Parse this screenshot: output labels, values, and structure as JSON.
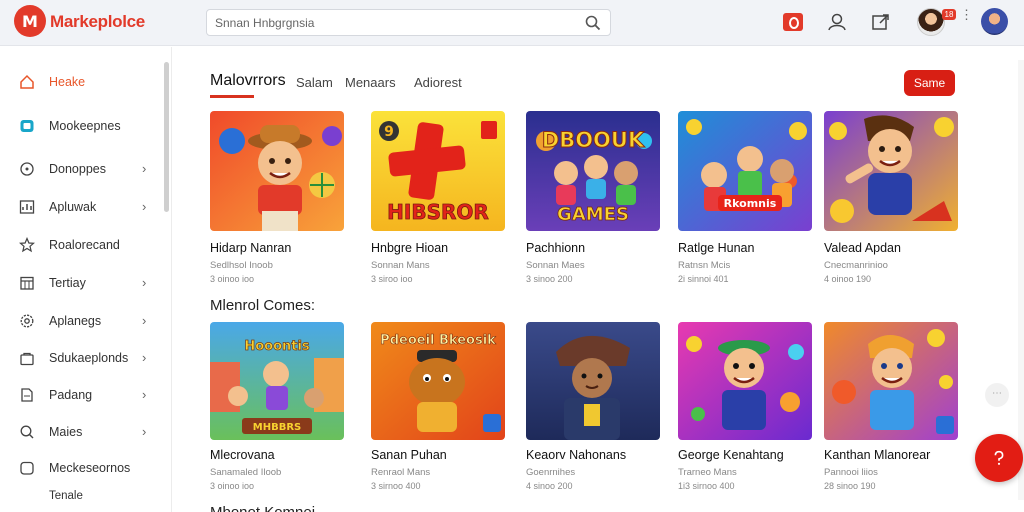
{
  "header": {
    "logo_letter": "M",
    "logo_text": "Markeplolce",
    "search_placeholder": "Snnan Hnbgrgnsia",
    "notification_badge": "18"
  },
  "sidebar": {
    "items": [
      {
        "label": "Heake",
        "icon": "home-icon",
        "chevron": false
      },
      {
        "label": "Mookeepnes",
        "icon": "market-icon",
        "chevron": false
      },
      {
        "label": "Donoppes",
        "icon": "circle-icon",
        "chevron": true
      },
      {
        "label": "Apluwak",
        "icon": "chart-icon",
        "chevron": true
      },
      {
        "label": "Roalorecand",
        "icon": "star-icon",
        "chevron": false
      },
      {
        "label": "Tertiay",
        "icon": "calendar-icon",
        "chevron": true
      },
      {
        "label": "Aplanegs",
        "icon": "gear-icon",
        "chevron": true
      },
      {
        "label": "Sdukaeplonds",
        "icon": "bag-icon",
        "chevron": true
      },
      {
        "label": "Padang",
        "icon": "note-icon",
        "chevron": true
      },
      {
        "label": "Maies",
        "icon": "search-icon",
        "chevron": true
      },
      {
        "label": "Meckeseornos",
        "icon": "box-icon",
        "chevron": false
      },
      {
        "label": "Tenale",
        "icon": "",
        "chevron": false
      }
    ]
  },
  "tabs": [
    "Malovrrors",
    "Salam",
    "Menaars",
    "Adiorest"
  ],
  "save_label": "Same",
  "section_title": "Mlenrol Comes:",
  "bottom_title": "Mbonot Komnei",
  "cards_row1": [
    {
      "title": "Hidarp Nanran",
      "sub": "Sedlhsol Inoob",
      "meta": "3 oinoo ioo",
      "art_text": ""
    },
    {
      "title": "Hnbgre Hioan",
      "sub": "Sonnan Mans",
      "meta": "3 siroo ioo",
      "art_text": "HIBSROR"
    },
    {
      "title": "Pachhionn",
      "sub": "Sonnan Maes",
      "meta": "3 sinoo 200",
      "art_text_top": "DBOOUK",
      "art_text": "GAMES"
    },
    {
      "title": "Ratlge Hunan",
      "sub": "Ratnsn Mcis",
      "meta": "2i sinnoi 401",
      "art_text": "Rkomnis"
    },
    {
      "title": "Valead Apdan",
      "sub": "Cnecmanrinioo",
      "meta": "4 oinoo 190",
      "art_text": ""
    }
  ],
  "cards_row2": [
    {
      "title": "Mlecrovana",
      "sub": "Sanamaled Iloob",
      "meta": "3 oinoo ioo",
      "art_text_top": "Hooontis",
      "art_text": "MHBBRS"
    },
    {
      "title": "Sanan Puhan",
      "sub": "Renraol Mans",
      "meta": "3 sirnoo 400",
      "art_text_top": "Pdeoeil Bkeosik",
      "art_text": ""
    },
    {
      "title": "Keaorv Nahonans",
      "sub": "Goenrnihes",
      "meta": "4 sinoo 200",
      "art_text": ""
    },
    {
      "title": "George Kenahtang",
      "sub": "Trarneo Mans",
      "meta": "1i3 sirnoo 400",
      "art_text": ""
    },
    {
      "title": "Kanthan Mlanorear",
      "sub": "Pannooi liios",
      "meta": "28 sinoo 190",
      "art_text": ""
    }
  ],
  "colors": {
    "accent": "#d81f14",
    "active_nav": "#e8562a"
  }
}
